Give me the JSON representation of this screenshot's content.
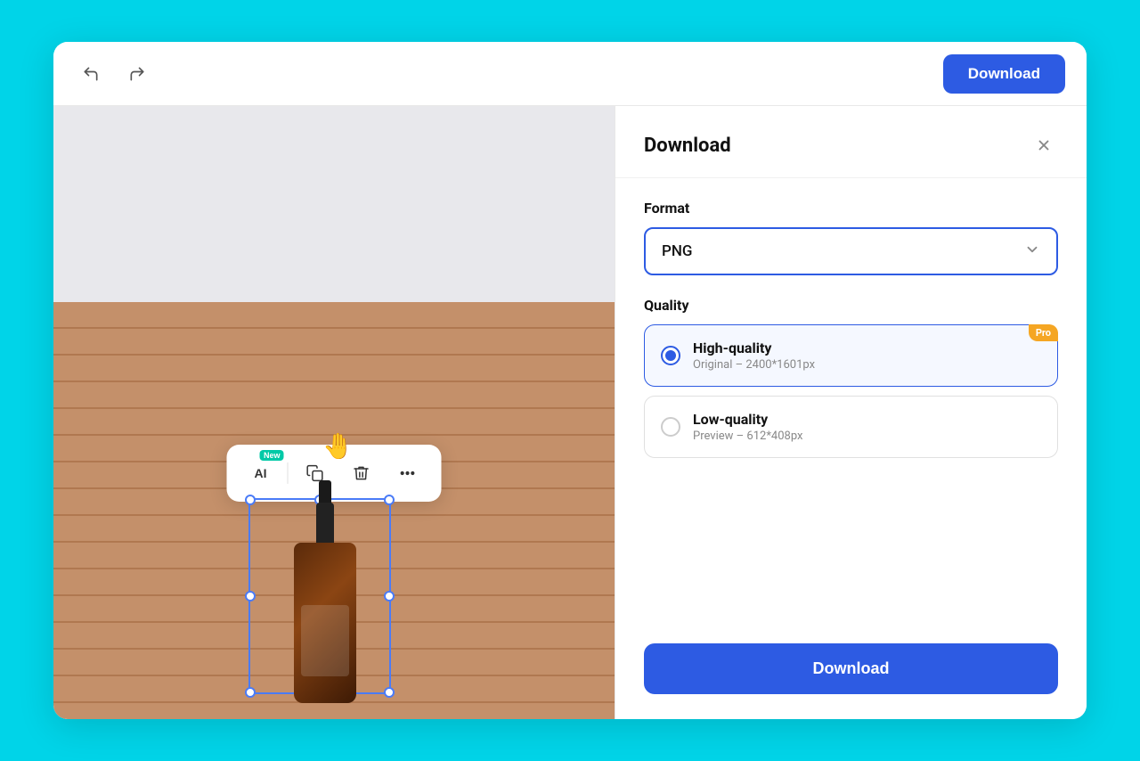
{
  "toolbar": {
    "download_label": "Download"
  },
  "floating_toolbar": {
    "ai_button_label": "AI",
    "new_badge": "New",
    "copy_button_label": "Copy",
    "delete_button_label": "Delete",
    "more_button_label": "More"
  },
  "download_panel": {
    "title": "Download",
    "format_label": "Format",
    "format_value": "PNG",
    "quality_label": "Quality",
    "quality_options": [
      {
        "name": "High-quality",
        "desc": "Original – 2400*1601px",
        "selected": true,
        "pro": true,
        "pro_label": "Pro"
      },
      {
        "name": "Low-quality",
        "desc": "Preview – 612*408px",
        "selected": false,
        "pro": false
      }
    ],
    "download_button_label": "Download"
  }
}
